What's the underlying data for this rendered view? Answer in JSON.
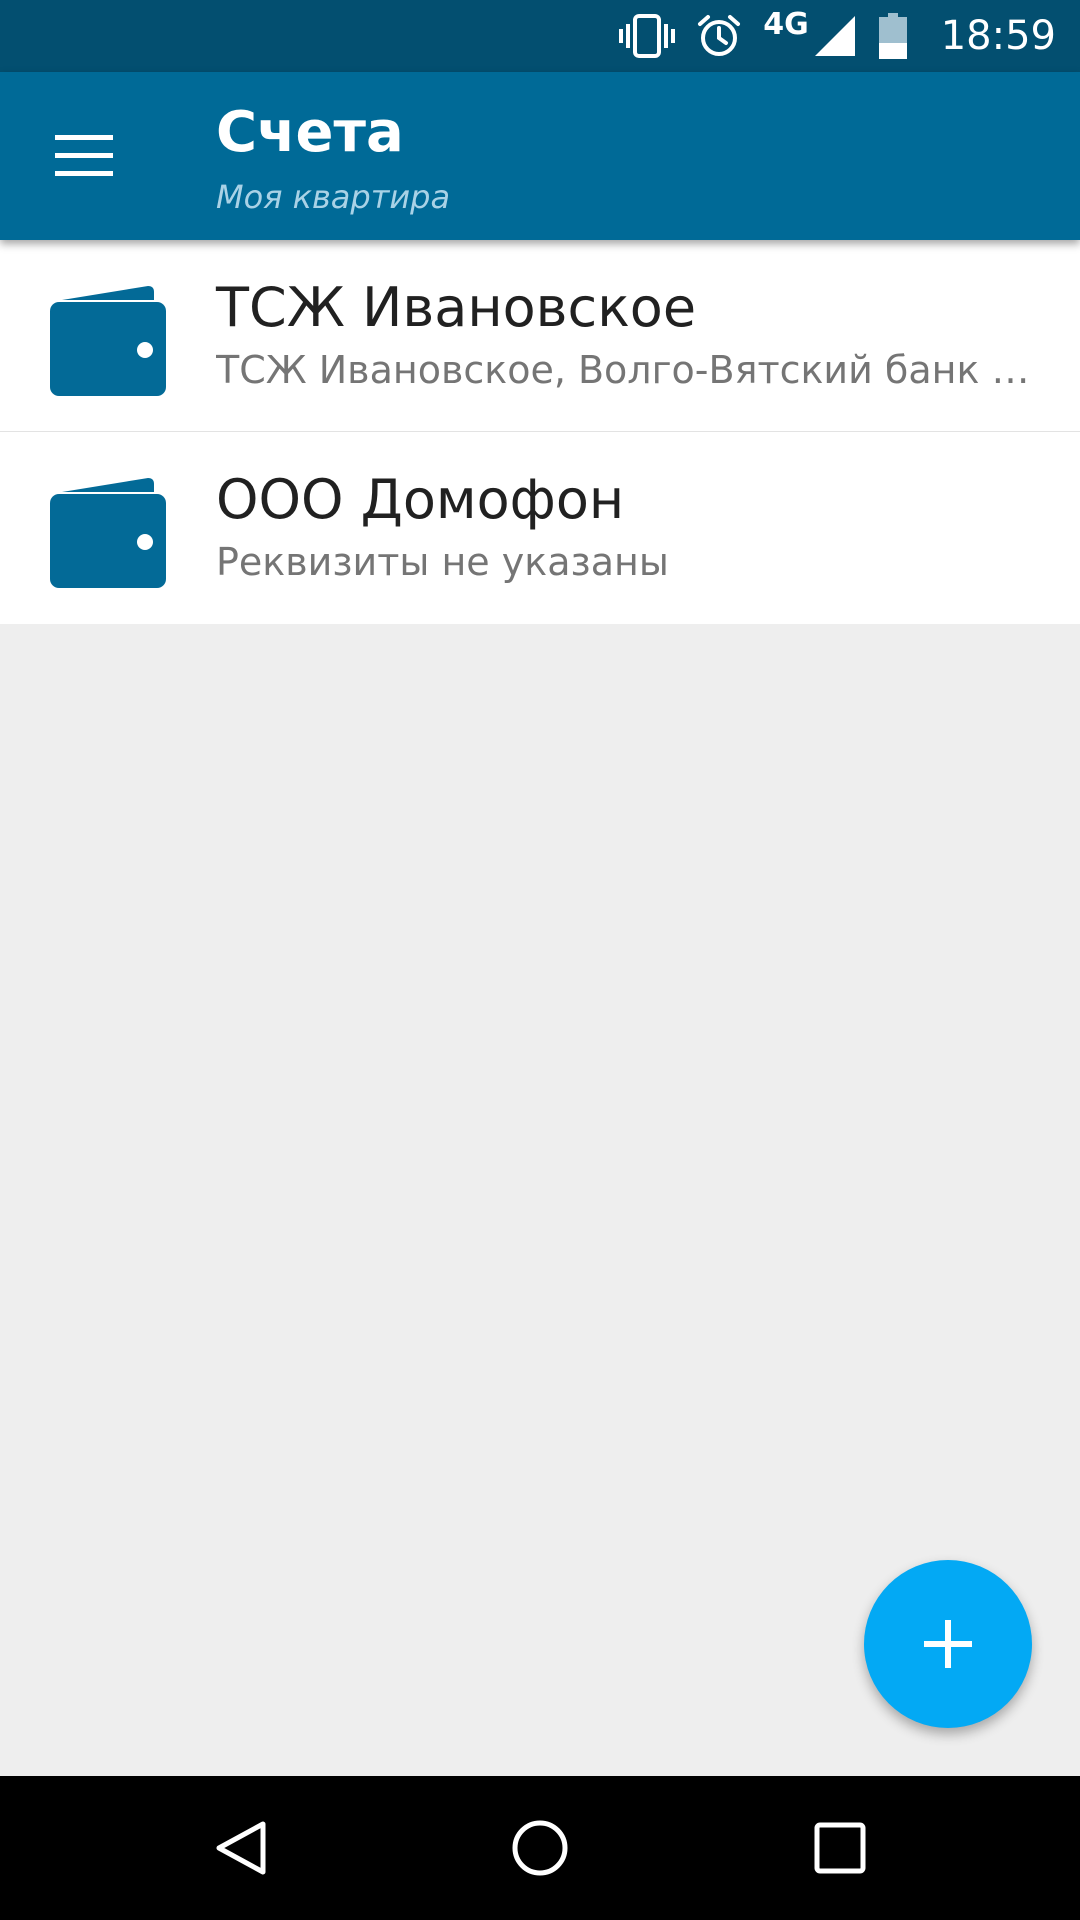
{
  "status_bar": {
    "network": "4G",
    "time": "18:59",
    "icons": [
      "vibrate-icon",
      "alarm-icon",
      "signal-icon",
      "battery-icon"
    ]
  },
  "app_bar": {
    "title": "Счета",
    "subtitle": "Моя квартира",
    "menu_icon": "menu-icon"
  },
  "accounts": [
    {
      "title": "ТСЖ Ивановское",
      "subtitle": "ТСЖ Ивановское, Волго-Вятский банк П...",
      "icon": "wallet-icon"
    },
    {
      "title": "ООО Домофон",
      "subtitle": "Реквизиты не указаны",
      "icon": "wallet-icon"
    }
  ],
  "fab": {
    "icon": "plus-icon"
  },
  "nav_bar": {
    "icons": [
      "back-icon",
      "home-icon",
      "recents-icon"
    ]
  },
  "colors": {
    "status_bar": "#034f70",
    "app_bar": "#006a97",
    "accent": "#03a9f4",
    "wallet": "#036a97"
  }
}
